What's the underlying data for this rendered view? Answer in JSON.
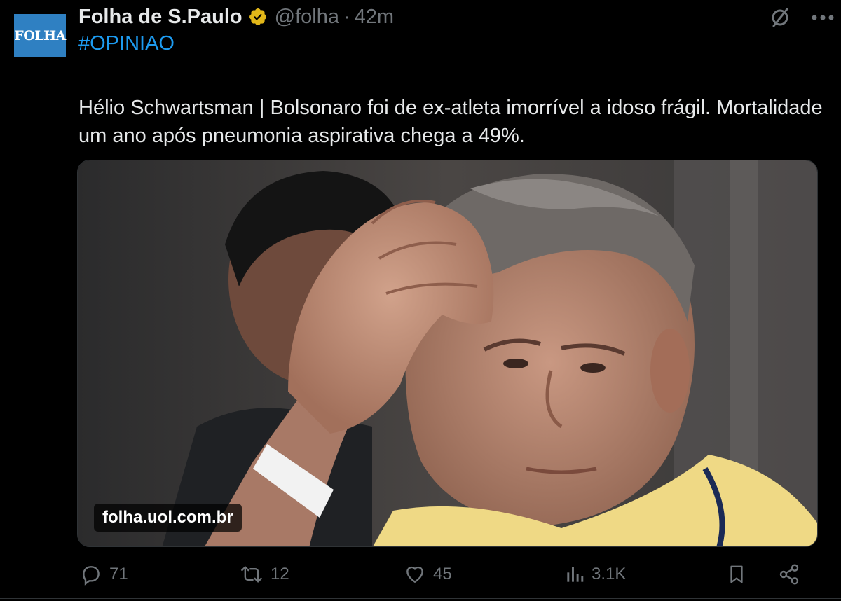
{
  "account": {
    "avatar_text": "FOLHA",
    "display_name": "Folha de S.Paulo",
    "handle": "@folha",
    "separator": "·",
    "time": "42m",
    "verified_icon": "verified-badge-icon"
  },
  "tweet": {
    "hashtag": "#OPINIAO",
    "text": "Hélio Schwartsman | Bolsonaro foi de ex-atleta imorrível a idoso frágil. Mortalidade um ano após pneumonia aspirativa chega a 49%.",
    "link_domain": "folha.uol.com.br"
  },
  "actions": {
    "replies": "71",
    "reposts": "12",
    "likes": "45",
    "views": "3.1K"
  },
  "colors": {
    "background": "#000000",
    "text": "#e7e9ea",
    "muted": "#71767b",
    "accent": "#1d9bf0",
    "verified_gold": "#e2b719",
    "avatar_blue": "#2f80c2"
  }
}
